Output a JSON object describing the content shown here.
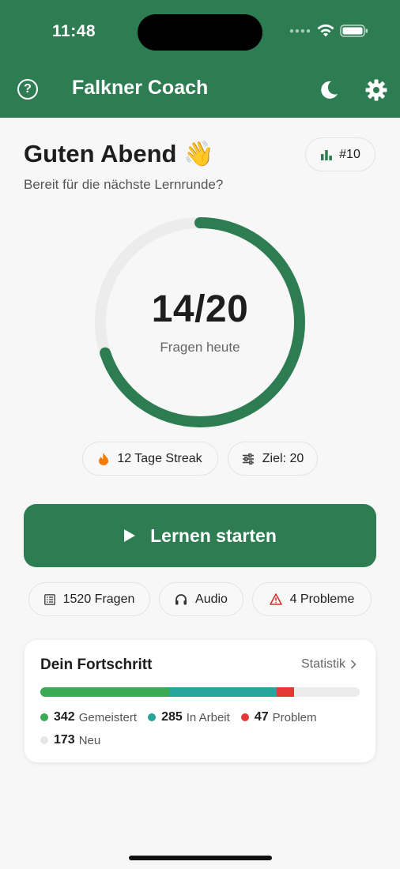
{
  "status_bar": {
    "time": "11:48"
  },
  "header": {
    "title": "Falkner Coach"
  },
  "greeting": {
    "title": "Guten Abend",
    "emoji": "👋",
    "subtitle": "Bereit für die nächste Lernrunde?"
  },
  "rank": {
    "label": "#10"
  },
  "daily_progress": {
    "value_text": "14/20",
    "label": "Fragen heute",
    "current": 14,
    "goal": 20
  },
  "streak": {
    "label": "12 Tage Streak"
  },
  "goal": {
    "label": "Ziel: 20"
  },
  "start_button": {
    "label": "Lernen starten"
  },
  "stats": {
    "questions": "1520 Fragen",
    "audio": "Audio",
    "problems": "4 Probleme"
  },
  "progress_card": {
    "title": "Dein Fortschritt",
    "link": "Statistik",
    "items": [
      {
        "count": "342",
        "label": "Gemeistert",
        "value": 342,
        "color": "#3aaa55"
      },
      {
        "count": "285",
        "label": "In Arbeit",
        "value": 285,
        "color": "#26a69a"
      },
      {
        "count": "47",
        "label": "Problem",
        "value": 47,
        "color": "#e53935"
      },
      {
        "count": "173",
        "label": "Neu",
        "value": 173,
        "color": "#e6e6e6"
      }
    ]
  },
  "colors": {
    "brand": "#2e7d52",
    "streak": "#f57c00",
    "warning": "#d32f2f"
  }
}
